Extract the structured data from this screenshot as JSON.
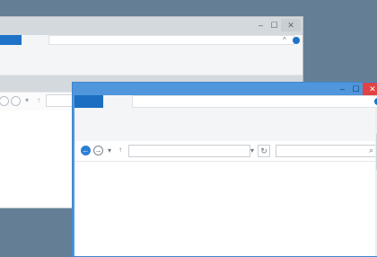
{
  "back_window": {
    "caption": {
      "minimize": "–",
      "maximize": "☐",
      "close": "✕"
    },
    "ribbon_collapse_glyph": "^"
  },
  "front_window": {
    "caption": {
      "minimize": "–",
      "maximize": "☐",
      "close": "✕"
    },
    "ribbon_collapse_glyph": "^",
    "address_bar": {
      "value": "",
      "dropdown_glyph": "▾",
      "refresh_glyph": "↻"
    },
    "search_box": {
      "value": "",
      "search_glyph": "⌕"
    },
    "nav": {
      "back_glyph": "←",
      "forward_glyph": "→",
      "recent_glyph": "▾",
      "up_glyph": "↑"
    }
  },
  "colors": {
    "desktop": "#647f95",
    "window_frame_active": "#4f96dc",
    "close_active": "#e04343",
    "accent": "#1e73c8"
  }
}
